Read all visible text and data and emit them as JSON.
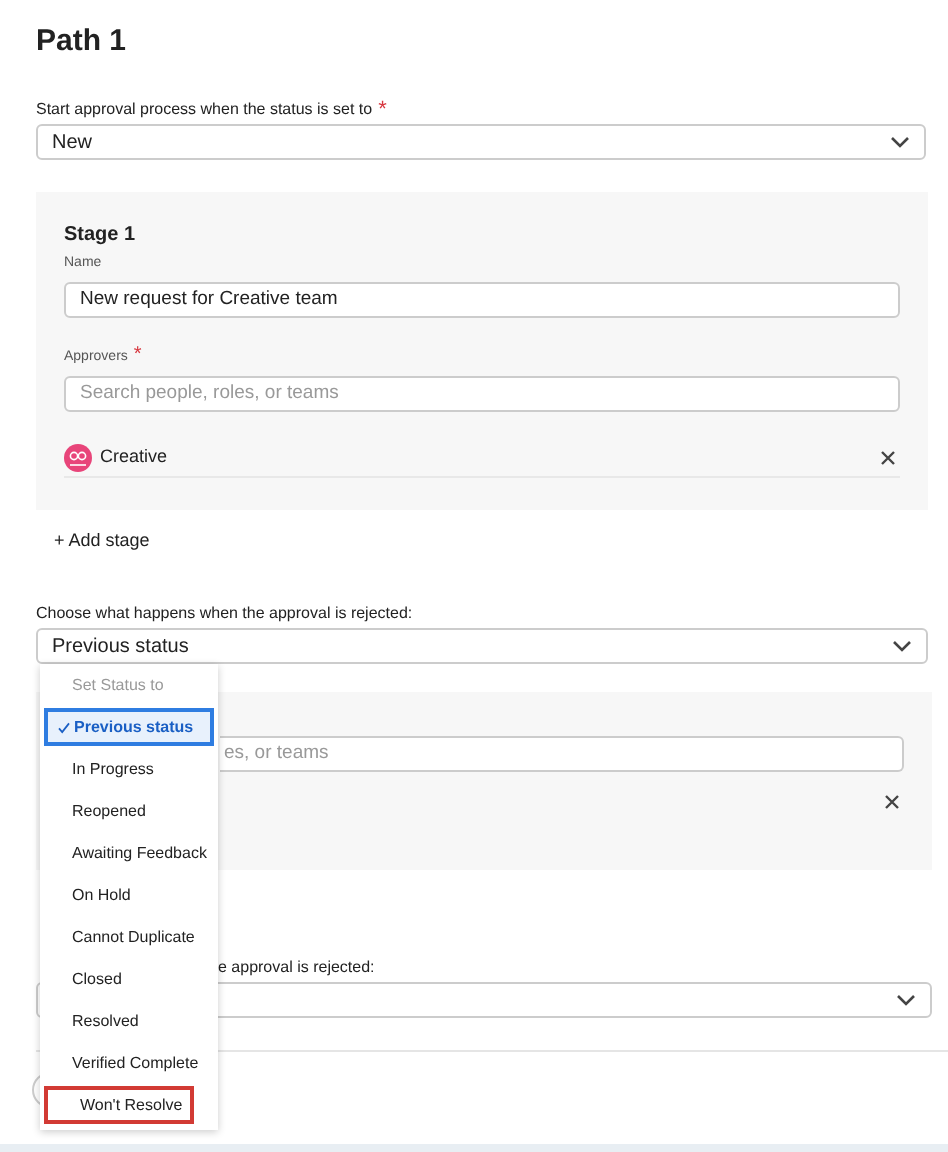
{
  "title": "Path 1",
  "start": {
    "label": "Start approval process when the status is set to",
    "required_mark": "*",
    "value": "New"
  },
  "stage": {
    "title": "Stage 1",
    "name_label": "Name",
    "name_value": "New request for Creative team",
    "approvers_label": "Approvers",
    "required_mark": "*",
    "approvers_placeholder": "Search people, roles, or teams",
    "approvers": [
      {
        "name": "Creative",
        "color": "#e8457a"
      }
    ]
  },
  "add_stage": "+ Add stage",
  "reject": {
    "label": "Choose what happens when the approval is rejected:",
    "value": "Previous status"
  },
  "menu": {
    "header": "Set Status to",
    "items": [
      {
        "label": "Previous status",
        "selected": true,
        "highlighted": false
      },
      {
        "label": "In Progress",
        "selected": false,
        "highlighted": false
      },
      {
        "label": "Reopened",
        "selected": false,
        "highlighted": false
      },
      {
        "label": "Awaiting Feedback",
        "selected": false,
        "highlighted": false
      },
      {
        "label": "On Hold",
        "selected": false,
        "highlighted": false
      },
      {
        "label": "Cannot Duplicate",
        "selected": false,
        "highlighted": false
      },
      {
        "label": "Closed",
        "selected": false,
        "highlighted": false
      },
      {
        "label": "Resolved",
        "selected": false,
        "highlighted": false
      },
      {
        "label": "Verified Complete",
        "selected": false,
        "highlighted": false
      },
      {
        "label": "Won't Resolve",
        "selected": false,
        "highlighted": true
      }
    ]
  },
  "behind": {
    "search_fragment": "es, or teams",
    "label_fragment": "e approval is rejected:"
  }
}
